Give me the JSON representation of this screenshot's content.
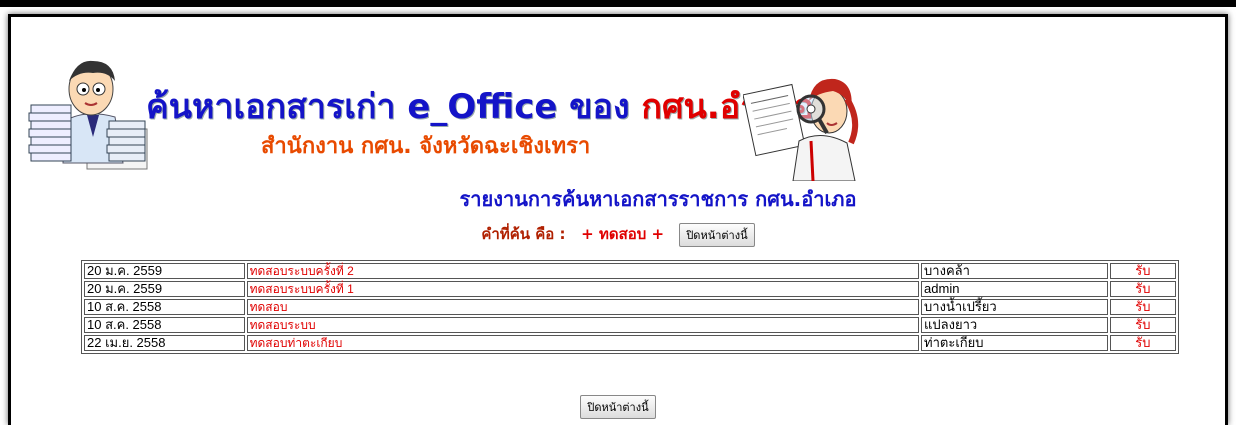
{
  "header": {
    "title_prefix": "ค้นหาเอกสารเก่า e_Office ของ ",
    "title_highlight": "กศน.อำเภอ",
    "subtitle": "สำนักงาน กศน. จังหวัดฉะเชิงเทรา"
  },
  "report": {
    "title": "รายงานการค้นหาเอกสารราชการ กศน.อำเภอ",
    "search_label": "คำที่ค้น คือ :",
    "search_term": "+ ทดสอบ +",
    "close_button_label": "ปิดหน้าต่างนี้"
  },
  "results": [
    {
      "date": "20 ม.ค. 2559",
      "subject": "ทดสอบระบบครั้งที่ 2",
      "office": "บางคล้า",
      "action": "รับ"
    },
    {
      "date": "20 ม.ค. 2559",
      "subject": "ทดสอบระบบครั้งที่ 1",
      "office": "admin",
      "action": "รับ"
    },
    {
      "date": "10 ส.ค. 2558",
      "subject": "ทดสอบ",
      "office": "บางน้ำเปรี้ยว",
      "action": "รับ"
    },
    {
      "date": "10 ส.ค. 2558",
      "subject": "ทดสอบระบบ",
      "office": "แปลงยาว",
      "action": "รับ"
    },
    {
      "date": "22 เม.ย. 2558",
      "subject": "ทดสอบท่าตะเกียบ",
      "office": "ท่าตะเกียบ",
      "action": "รับ"
    }
  ],
  "footer": {
    "close_button_label": "ปิดหน้าต่างนี้"
  },
  "colors": {
    "title_blue": "#1414c8",
    "title_red": "#e00000",
    "subtitle_orange": "#e84a00",
    "link_red": "#e00000"
  },
  "icons": [
    "office-clerk-illustration",
    "detective-magnifier-illustration"
  ]
}
